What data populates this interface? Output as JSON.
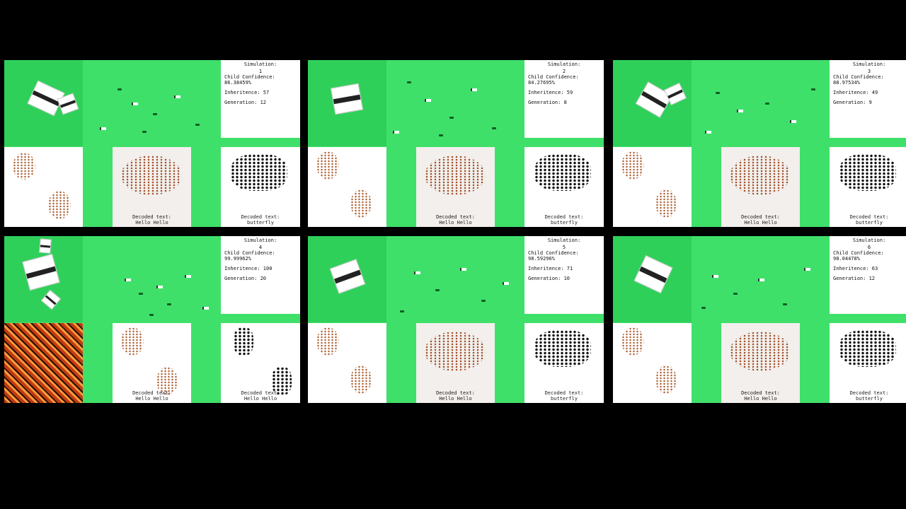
{
  "panels": [
    {
      "sim_label": "Simulation:",
      "sim_num": "1",
      "confidence_label": "Child Confidence:",
      "confidence": "86.38459%",
      "inheritence": "Inheritence: 57",
      "generation": "Generation: 12",
      "decoded_label": "Decoded text:",
      "decoded_center": "Hello Hello",
      "decoded_right": "butterfly"
    },
    {
      "sim_label": "Simulation:",
      "sim_num": "2",
      "confidence_label": "Child Confidence:",
      "confidence": "84.27695%",
      "inheritence": "Inheritence: 59",
      "generation": "Generation: 8",
      "decoded_label": "Decoded text:",
      "decoded_center": "Hello Hello",
      "decoded_right": "butterfly"
    },
    {
      "sim_label": "Simulation:",
      "sim_num": "3",
      "confidence_label": "Child Confidence:",
      "confidence": "88.97534%",
      "inheritence": "Inheritence: 49",
      "generation": "Generation: 9",
      "decoded_label": "Decoded text:",
      "decoded_center": "Hello Hello",
      "decoded_right": "butterfly"
    },
    {
      "sim_label": "Simulation:",
      "sim_num": "4",
      "confidence_label": "Child Confidence:",
      "confidence": "99.99962%",
      "inheritence": "Inheritence: 100",
      "generation": "Generation: 20",
      "decoded_label": "Decoded text:",
      "decoded_center": "Hello Hello",
      "decoded_right": "Hello Hello"
    },
    {
      "sim_label": "Simulation:",
      "sim_num": "5",
      "confidence_label": "Child Confidence:",
      "confidence": "98.59296%",
      "inheritence": "Inheritence: 71",
      "generation": "Generation: 10",
      "decoded_label": "Decoded text:",
      "decoded_center": "Hello Hello",
      "decoded_right": "butterfly"
    },
    {
      "sim_label": "Simulation:",
      "sim_num": "6",
      "confidence_label": "Child Confidence:",
      "confidence": "98.04478%",
      "inheritence": "Inheritence: 63",
      "generation": "Generation: 12",
      "decoded_label": "Decoded text:",
      "decoded_center": "Hello Hello",
      "decoded_right": "butterfly"
    }
  ]
}
